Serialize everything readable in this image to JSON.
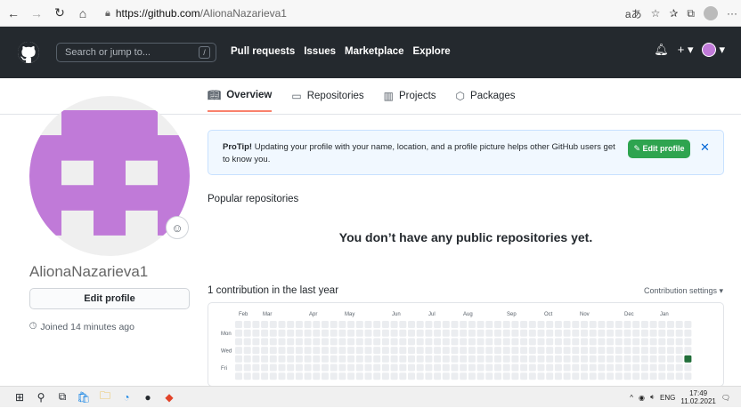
{
  "browser": {
    "url_host": "https://github.com",
    "url_path": "/AlionaNazarieva1",
    "icons": [
      "back-icon",
      "forward-icon",
      "refresh-icon",
      "home-icon",
      "lock-icon",
      "read-aloud-icon",
      "favorite-add-icon",
      "favorites-icon",
      "collections-icon",
      "profile-icon",
      "more-icon"
    ]
  },
  "header": {
    "search_placeholder": "Search or jump to...",
    "search_shortcut": "/",
    "nav": [
      "Pull requests",
      "Issues",
      "Marketplace",
      "Explore"
    ]
  },
  "tabs": [
    {
      "label": "Overview",
      "active": true,
      "icon": "book-icon"
    },
    {
      "label": "Repositories",
      "active": false,
      "icon": "repo-icon"
    },
    {
      "label": "Projects",
      "active": false,
      "icon": "project-icon"
    },
    {
      "label": "Packages",
      "active": false,
      "icon": "package-icon"
    }
  ],
  "profile": {
    "username": "AlionaNazarieva1",
    "edit_button": "Edit profile",
    "joined": "Joined 14 minutes ago",
    "avatar_color": "#c07ad8"
  },
  "protip": {
    "bold": "ProTip!",
    "text": " Updating your profile with your name, location, and a profile picture helps other GitHub users get to know you.",
    "button": "Edit profile"
  },
  "popular": {
    "title": "Popular repositories",
    "empty": "You don’t have any public repositories yet."
  },
  "contributions": {
    "title": "1 contribution in the last year",
    "settings": "Contribution settings ▾",
    "months": [
      "Feb",
      "Mar",
      "Apr",
      "May",
      "Jun",
      "Jul",
      "Aug",
      "Sep",
      "Oct",
      "Nov",
      "Dec",
      "Jan"
    ],
    "days": [
      "Mon",
      "Wed",
      "Fri"
    ],
    "empty_color": "#ebedf0",
    "active_color": "#216e39"
  },
  "taskbar": {
    "lang": "ENG",
    "time": "17:49",
    "date": "11.02.2021"
  }
}
